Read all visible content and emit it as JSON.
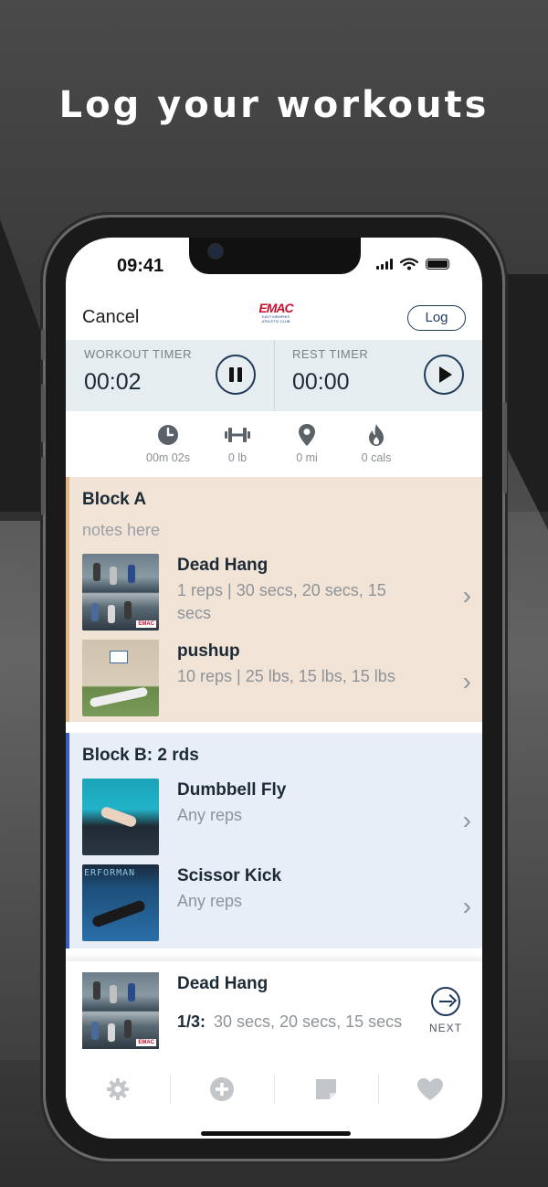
{
  "headline": "Log your workouts",
  "status": {
    "time": "09:41"
  },
  "nav": {
    "cancel": "Cancel",
    "logo_big": "EMAC",
    "logo_small": "EAST MEMPHIS ATHLETIC CLUB",
    "log": "Log"
  },
  "timers": {
    "workout": {
      "label": "WORKOUT TIMER",
      "value": "00:02",
      "control": "pause-icon"
    },
    "rest": {
      "label": "REST TIMER",
      "value": "00:00",
      "control": "play-icon"
    }
  },
  "stats": [
    {
      "icon": "clock-icon",
      "text": "00m 02s"
    },
    {
      "icon": "dumbbell-icon",
      "text": "0 lb"
    },
    {
      "icon": "location-pin-icon",
      "text": "0 mi"
    },
    {
      "icon": "flame-icon",
      "text": "0 cals"
    }
  ],
  "blockA": {
    "title": "Block A",
    "notes_placeholder": "notes here",
    "exercises": [
      {
        "name": "Dead Hang",
        "details": "1 reps | 30 secs, 20 secs, 15 secs"
      },
      {
        "name": "pushup",
        "details": "10 reps | 25 lbs, 15 lbs, 15 lbs"
      }
    ]
  },
  "blockB": {
    "title": "Block B: 2 rds",
    "exercises": [
      {
        "name": "Dumbbell Fly",
        "details": "Any reps"
      },
      {
        "name": "Scissor Kick",
        "details": "Any reps"
      }
    ]
  },
  "next": {
    "name": "Dead Hang",
    "set": "1/3:",
    "set_details": "30 secs, 20 secs, 15 secs",
    "button": "NEXT"
  },
  "thumb_text": {
    "brand_tag": "EMAC",
    "floor_word": "ERFORMAN"
  },
  "tabbar": [
    {
      "icon": "gear-icon"
    },
    {
      "icon": "plus-circle-icon"
    },
    {
      "icon": "note-icon"
    },
    {
      "icon": "heart-icon"
    }
  ],
  "colors": {
    "accent": "#1f3a5a",
    "blockA_bg": "#f1e4d7",
    "blockA_bar": "#e0b68a",
    "blockB_bg": "#e8eef8",
    "blockB_bar": "#3a5fb8"
  }
}
